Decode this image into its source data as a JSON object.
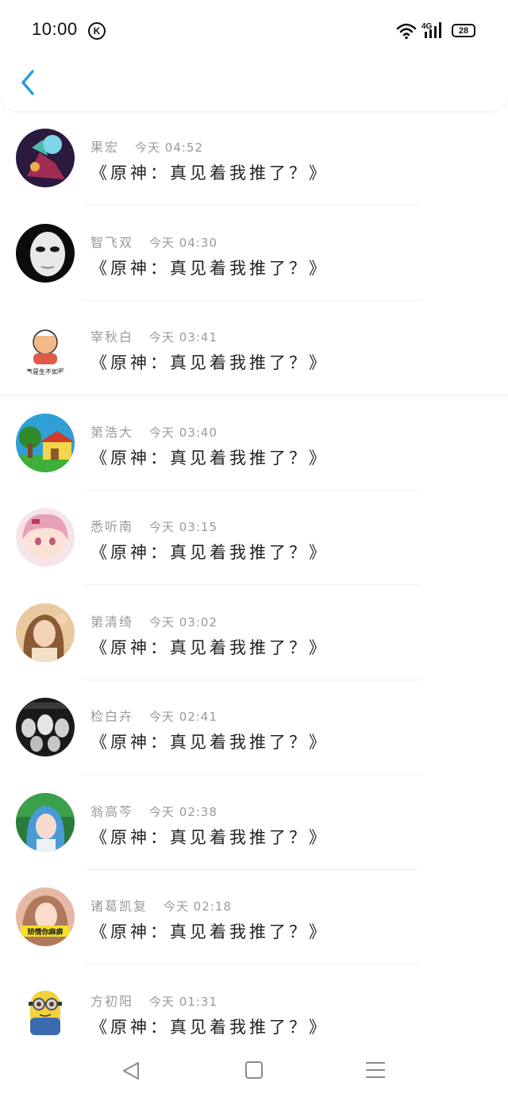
{
  "status_bar": {
    "time": "10:00",
    "k_badge": "K",
    "network": "4G",
    "battery": "28"
  },
  "header": {
    "back_icon": "chevron-left-icon",
    "accent": "#2d9cdb"
  },
  "comments": [
    {
      "name": "果宏",
      "time": "今天 04:52",
      "message": "《原神：真见着我推了？》",
      "avatar": "neon-figure"
    },
    {
      "name": "智飞双",
      "time": "今天 04:30",
      "message": "《原神：真见着我推了？》",
      "avatar": "white-mask"
    },
    {
      "name": "宰秋白",
      "time": "今天 03:41",
      "message": "《原神：真见着我推了？》",
      "avatar": "cartoon-man",
      "avatar_caption": "真是生不如死"
    },
    {
      "name": "第浩大",
      "time": "今天 03:40",
      "message": "《原神：真见着我推了？》",
      "avatar": "cartoon-house"
    },
    {
      "name": "悉听南",
      "time": "今天 03:15",
      "message": "《原神：真见着我推了？》",
      "avatar": "pink-anime-girl"
    },
    {
      "name": "第清绮",
      "time": "今天 03:02",
      "message": "《原神：真见着我推了？》",
      "avatar": "girl-photo"
    },
    {
      "name": "检白卉",
      "time": "今天 02:41",
      "message": "《原神：真见着我推了？》",
      "avatar": "mask-crowd"
    },
    {
      "name": "翁高芩",
      "time": "今天 02:38",
      "message": "《原神：真见着我推了？》",
      "avatar": "blue-hair-girl"
    },
    {
      "name": "诸葛凯复",
      "time": "今天 02:18",
      "message": "《原神：真见着我推了？》",
      "avatar": "girl-sticker",
      "avatar_caption": "矫情你麻痹"
    },
    {
      "name": "方初阳",
      "time": "今天 01:31",
      "message": "《原神：真见着我推了？》",
      "avatar": "minion"
    }
  ],
  "nav_bar": {
    "back": "triangle-back-icon",
    "home": "square-home-icon",
    "menu": "menu-lines-icon"
  }
}
